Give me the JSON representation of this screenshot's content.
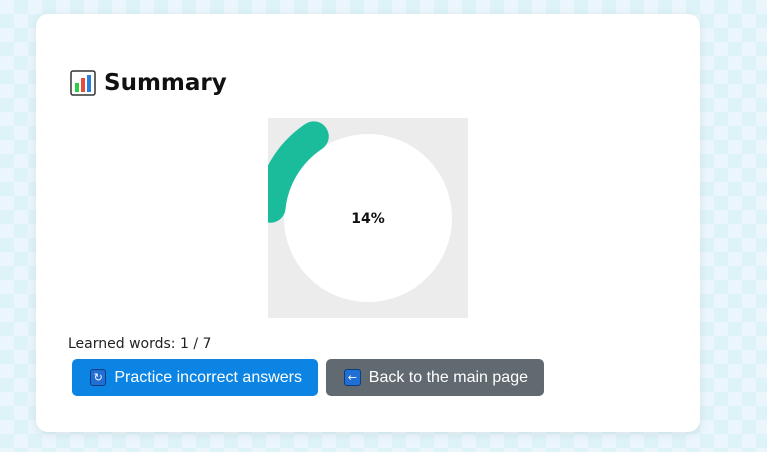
{
  "summary": {
    "title": "Summary",
    "title_icon": "bar-chart-icon"
  },
  "progress": {
    "label": "14%",
    "value_fraction": 0.14,
    "color": "#1abc9c",
    "track_color": "#ececec"
  },
  "learned": {
    "label": "Learned words:",
    "learned": "1",
    "separator": "/",
    "total": "7"
  },
  "buttons": {
    "practice": {
      "label": "Practice incorrect answers",
      "icon": "repeat-icon",
      "color": "#0b84e3"
    },
    "back": {
      "label": "Back to the main page",
      "icon": "arrow-left-icon",
      "color": "#626a71"
    }
  }
}
